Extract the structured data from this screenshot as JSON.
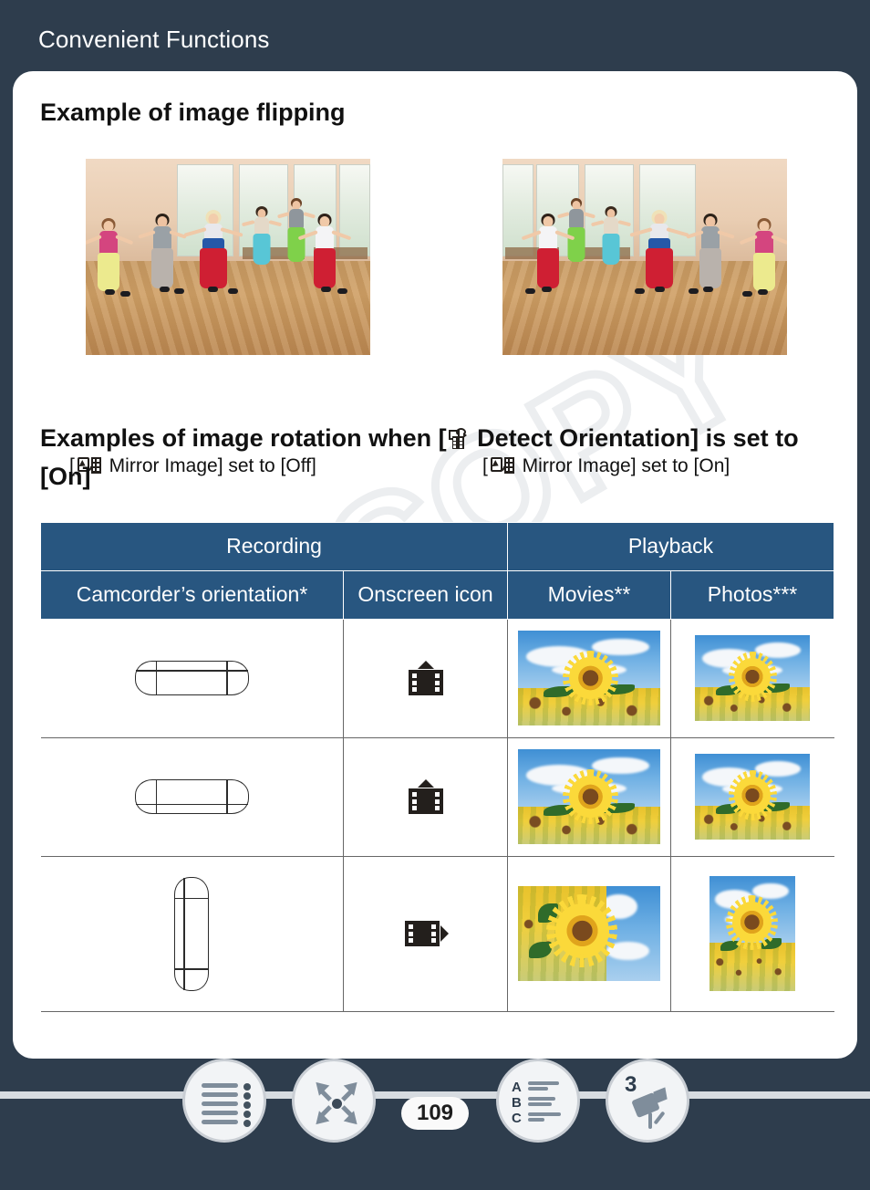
{
  "header": {
    "title": "Convenient Functions"
  },
  "sections": {
    "flip": {
      "title": "Example of image flipping",
      "caption_left_pre": "[",
      "caption_left_post": " Mirror Image] set to [Off]",
      "caption_right_pre": "[",
      "caption_right_post": " Mirror Image] set to [On]",
      "icon_name": "mirror-image-icon"
    },
    "rotation": {
      "title_part1": "Examples of image rotation when [",
      "title_part2": " Detect Orientation] is set to [On]",
      "icon_name": "detect-orientation-icon"
    }
  },
  "table": {
    "group_headers": [
      {
        "label": "Recording",
        "span": 2
      },
      {
        "label": "Playback",
        "span": 2
      }
    ],
    "column_headers": [
      "Camcorder’s orientation*",
      "Onscreen icon",
      "Movies**",
      "Photos***"
    ],
    "rows": [
      {
        "orientation": "horizontal-upright",
        "onscreen_icon": "film-strip-arrow-up-icon",
        "movie": "sunflower-landscape",
        "photo": "sunflower-landscape"
      },
      {
        "orientation": "horizontal-inverted",
        "onscreen_icon": "film-strip-arrow-up-icon",
        "movie": "sunflower-landscape",
        "photo": "sunflower-landscape"
      },
      {
        "orientation": "vertical",
        "onscreen_icon": "film-strip-arrow-right-icon",
        "movie": "sunflower-rotated",
        "photo": "sunflower-portrait"
      }
    ]
  },
  "watermark": {
    "text": "COPY"
  },
  "bottom_bar": {
    "page_number": "109",
    "buttons": [
      {
        "name": "table-of-contents-button",
        "icon": "toc-icon"
      },
      {
        "name": "fullscreen-button",
        "icon": "expand-arrows-icon"
      },
      {
        "name": "alphabetical-index-button",
        "icon": "abc-index-icon",
        "letters": [
          "A",
          "B",
          "C"
        ]
      },
      {
        "name": "camcorder-guide-button",
        "icon": "camcorder-icon",
        "badge": "3"
      }
    ]
  },
  "colors": {
    "page_background": "#2e3d4d",
    "card_background": "#ffffff",
    "table_header_blue": "#285680",
    "nav_button_fill": "#f2f4f6",
    "nav_icon_gray": "#7f8d9b"
  }
}
